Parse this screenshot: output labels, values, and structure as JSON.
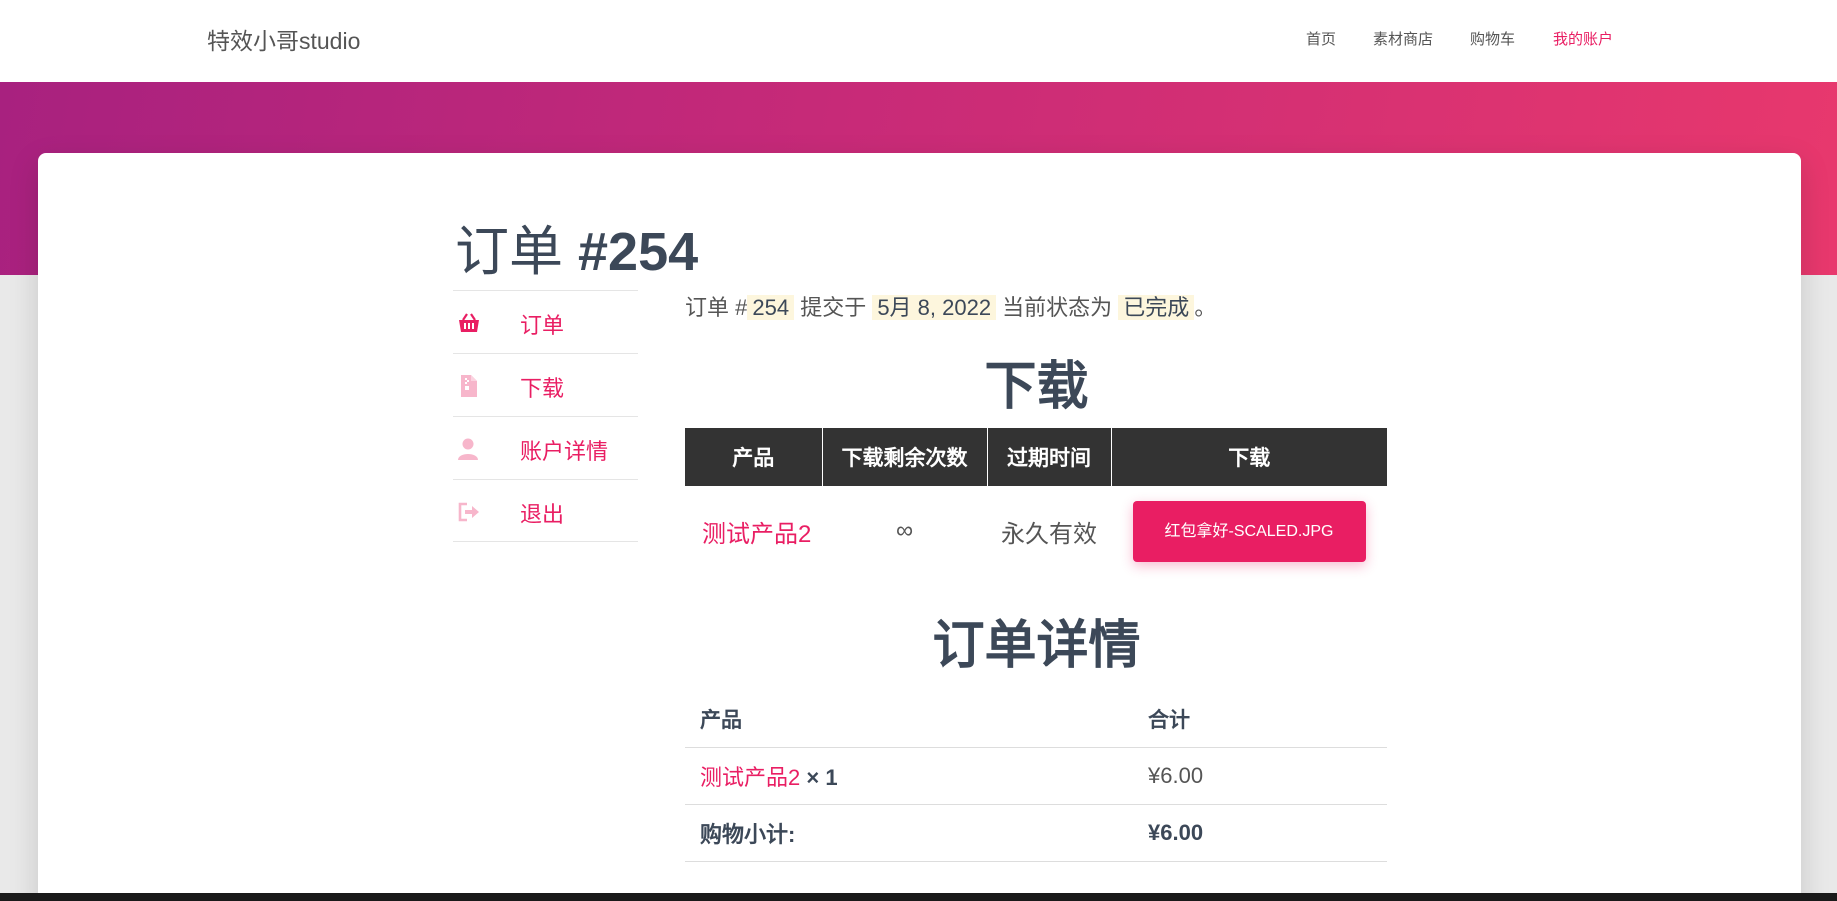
{
  "header": {
    "brand": "特效小哥studio",
    "nav": [
      {
        "label": "首页",
        "active": false
      },
      {
        "label": "素材商店",
        "active": false
      },
      {
        "label": "购物车",
        "active": false
      },
      {
        "label": "我的账户",
        "active": true
      }
    ]
  },
  "page": {
    "title_prefix": "订单",
    "title_number": "#254"
  },
  "sidebar": {
    "items": [
      {
        "label": "订单",
        "icon": "basket-icon"
      },
      {
        "label": "下载",
        "icon": "file-icon"
      },
      {
        "label": "账户详情",
        "icon": "user-icon"
      },
      {
        "label": "退出",
        "icon": "sign-out-icon"
      }
    ]
  },
  "summary": {
    "t1": "订单 #",
    "order_no": "254",
    "t2": " 提交于 ",
    "date": "5月 8, 2022",
    "t3": " 当前状态为 ",
    "status": "已完成",
    "t4": "。"
  },
  "downloads": {
    "title": "下载",
    "headers": [
      "产品",
      "下载剩余次数",
      "过期时间",
      "下载"
    ],
    "row": {
      "product": "测试产品2",
      "remaining": "∞",
      "expires": "永久有效",
      "file": "红包拿好-SCALED.JPG"
    }
  },
  "order_details": {
    "title": "订单详情",
    "headers": [
      "产品",
      "合计"
    ],
    "item_name": "测试产品2",
    "item_qty": " × 1",
    "item_total": "¥6.00",
    "subtotal_label": "购物小计:",
    "subtotal_value": "¥6.00"
  },
  "colors": {
    "accent": "#e91e63",
    "hero_start": "#a8217f",
    "hero_end": "#e8386d",
    "table_header": "#333333",
    "highlight": "#fdf6dd"
  }
}
